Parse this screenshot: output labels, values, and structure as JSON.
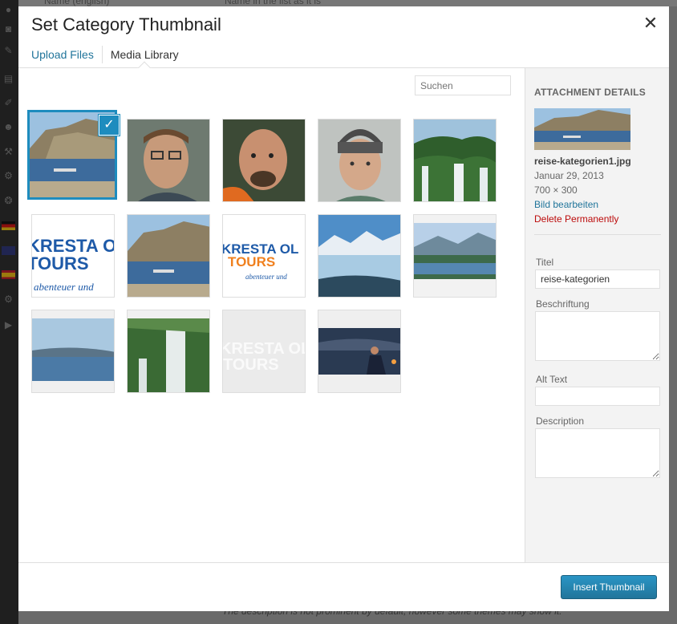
{
  "background": {
    "top_left_text": "Name (english)",
    "top_mid_text": "Name in the list as it is",
    "bottom_text": "The description is not prominent by default; however some themes may show it."
  },
  "modal": {
    "title": "Set Category Thumbnail",
    "close_icon": "close-icon",
    "tabs": [
      {
        "label": "Upload Files",
        "active": false
      },
      {
        "label": "Media Library",
        "active": true
      }
    ],
    "search_placeholder": "Suchen"
  },
  "attachments": [
    {
      "kind": "lake",
      "selected": true
    },
    {
      "kind": "man-glasses",
      "selected": false
    },
    {
      "kind": "man-bald",
      "selected": false
    },
    {
      "kind": "woman-hat",
      "selected": false
    },
    {
      "kind": "waterfall",
      "selected": false
    },
    {
      "kind": "logo",
      "selected": false
    },
    {
      "kind": "lake",
      "selected": false
    },
    {
      "kind": "logo-small",
      "selected": false
    },
    {
      "kind": "glacier",
      "selected": false
    },
    {
      "kind": "lake-town",
      "selected": false
    },
    {
      "kind": "lake-wide",
      "selected": false
    },
    {
      "kind": "waterfall-close",
      "selected": false
    },
    {
      "kind": "logo-faded",
      "selected": false
    },
    {
      "kind": "night-person",
      "selected": false
    }
  ],
  "logo_text": {
    "line1": "KRESTA OL",
    "line2": "TOURS",
    "tagline": "abenteuer und"
  },
  "details": {
    "heading": "ATTACHMENT DETAILS",
    "filename": "reise-kategorien1.jpg",
    "date": "Januar 29, 2013",
    "dimensions": "700 × 300",
    "edit_link": "Bild bearbeiten",
    "delete_link": "Delete Permanently",
    "fields": {
      "title_label": "Titel",
      "title_value": "reise-kategorien",
      "caption_label": "Beschriftung",
      "alt_label": "Alt Text",
      "description_label": "Description"
    }
  },
  "toolbar": {
    "insert_label": "Insert Thumbnail"
  },
  "colors": {
    "accent": "#1e8cbe",
    "link": "#21759b",
    "danger": "#bc0b0b"
  }
}
